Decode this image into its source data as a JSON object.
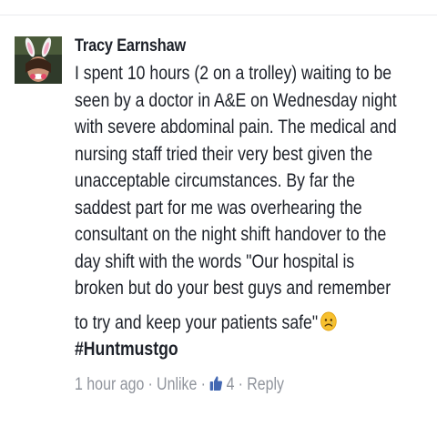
{
  "comment": {
    "author": "Tracy Earnshaw",
    "lines": [
      "I spent 10 hours (2 on a trolley) waiting to be",
      "seen by a doctor in A&E on Wednesday night",
      "with severe abdominal pain. The medical and",
      "nursing staff tried their very best given the",
      "unacceptable circumstances. By far the",
      "saddest part for me was overhearing the",
      "consultant on the night shift handover to the",
      "day shift with the words \"Our hospital is",
      "broken but do your best guys and remember",
      "to try and keep your patients safe\""
    ],
    "emoji": "sad-face-emoji",
    "hashtag": "#Huntmustgo"
  },
  "meta": {
    "time": "1 hour ago",
    "separator": "·",
    "unlike_label": "Unlike",
    "like_count": "4",
    "reply_label": "Reply"
  },
  "colors": {
    "text": "#1d2129",
    "meta": "#90949c",
    "like_blue": "#4267b2"
  }
}
